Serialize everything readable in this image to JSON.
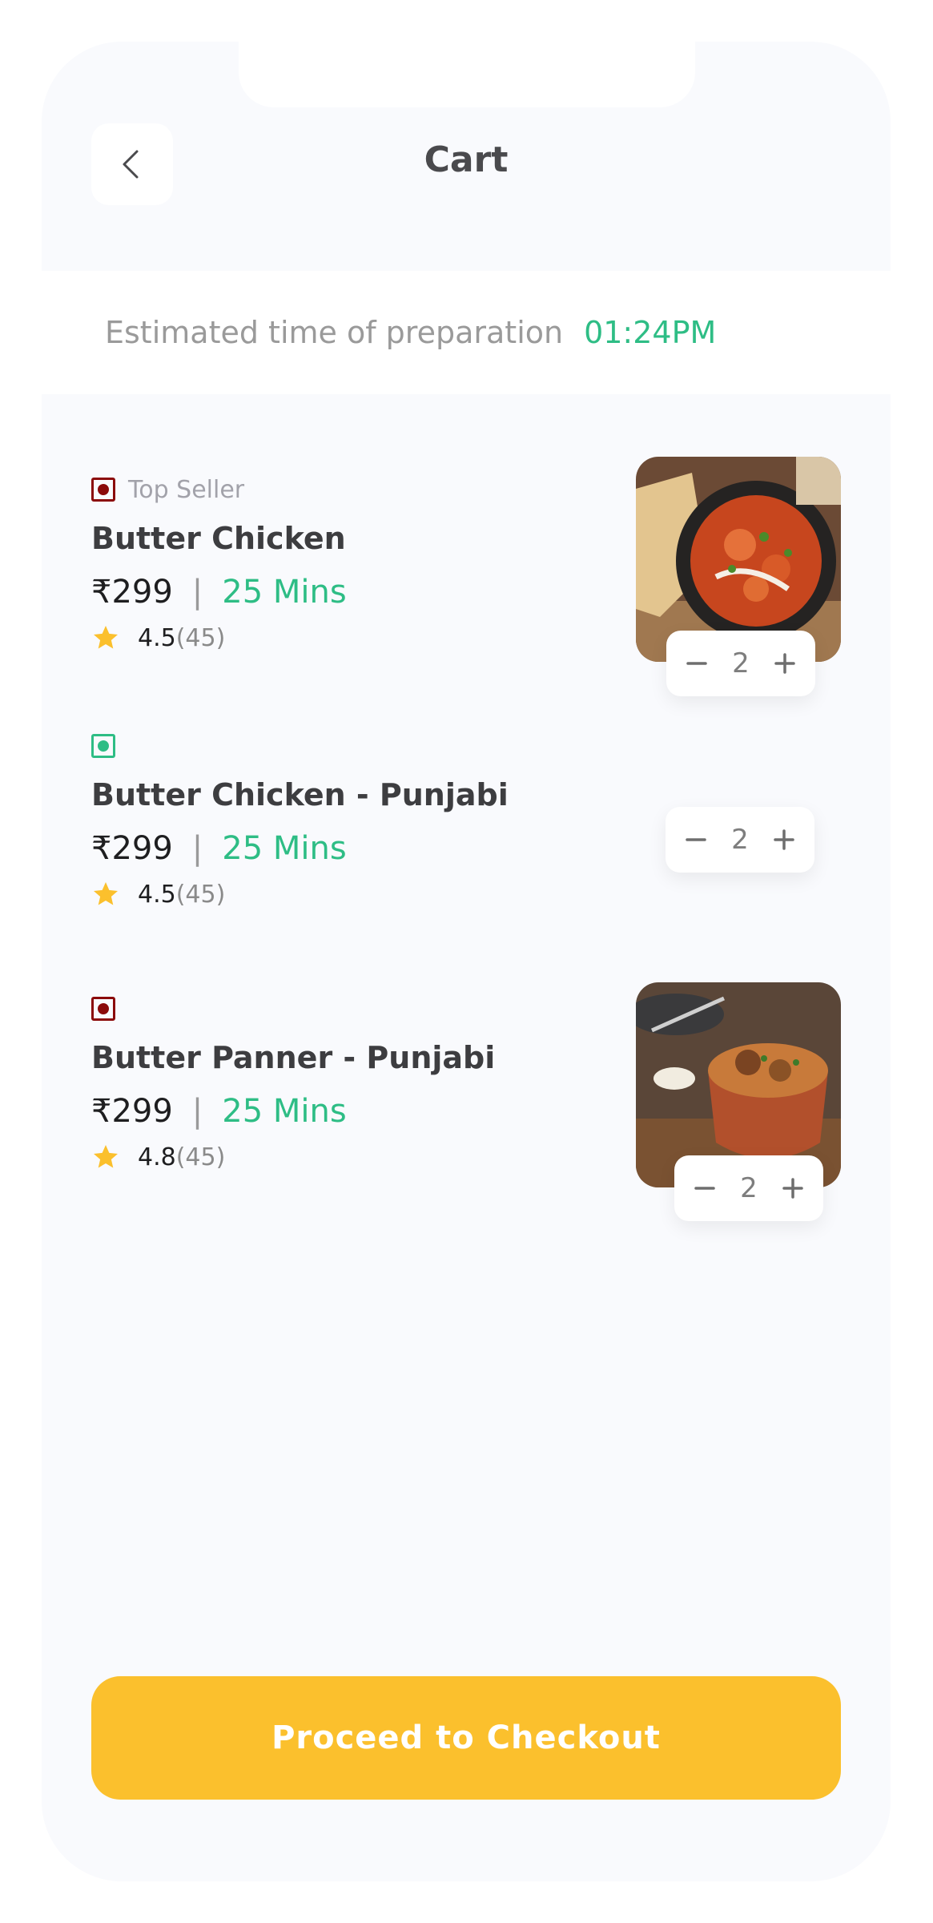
{
  "header": {
    "title": "Cart"
  },
  "estimate": {
    "label": "Estimated time of preparation",
    "time": "01:24PM"
  },
  "items": [
    {
      "badge": "Top Seller",
      "type": "nonveg",
      "name": "Butter Chicken",
      "price": "₹299",
      "separator": "|",
      "time": "25 Mins",
      "rating": "4.5",
      "count": "(45)",
      "qty": "2",
      "image": "butter-chicken-photo"
    },
    {
      "badge": "",
      "type": "veg",
      "name": "Butter Chicken - Punjabi",
      "price": "₹299",
      "separator": "|",
      "time": "25 Mins",
      "rating": "4.5",
      "count": "(45)",
      "qty": "2",
      "image": ""
    },
    {
      "badge": "",
      "type": "nonveg",
      "name": "Butter Panner - Punjabi",
      "price": "₹299",
      "separator": "|",
      "time": "25 Mins",
      "rating": "4.8",
      "count": "(45)",
      "qty": "2",
      "image": "biryani-photo"
    }
  ],
  "checkout": {
    "label": "Proceed to Checkout"
  },
  "colors": {
    "accent_green": "#2ebd85",
    "checkout_yellow": "#fbc02d",
    "nonveg_red": "#8b0a0a",
    "star": "#fbc02d"
  }
}
